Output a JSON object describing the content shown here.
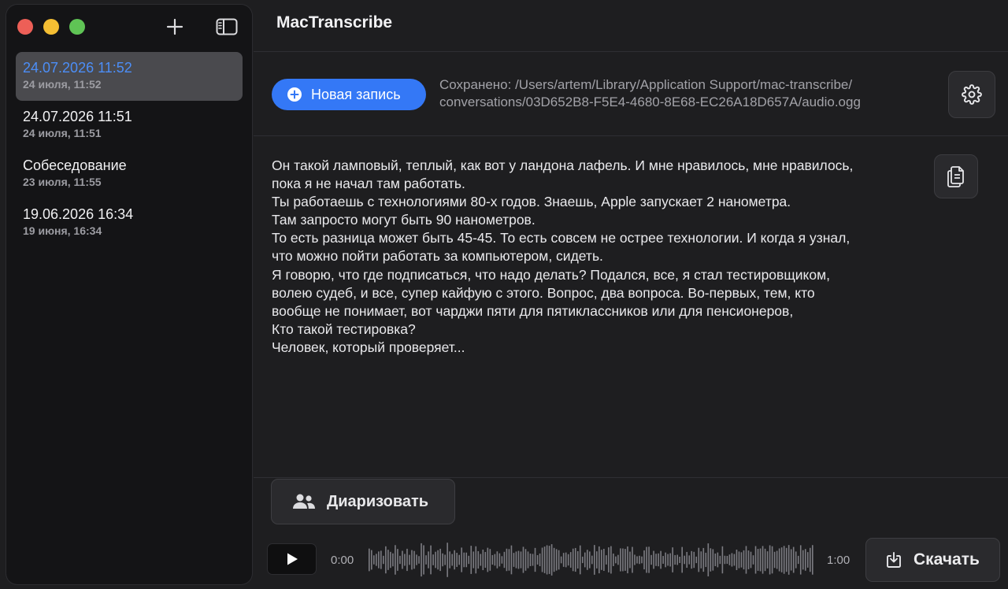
{
  "app": {
    "title": "MacTranscribe"
  },
  "sidebar": {
    "items": [
      {
        "title": "24.07.2026 11:52",
        "subtitle": "24 июля, 11:52",
        "selected": true
      },
      {
        "title": "24.07.2026 11:51",
        "subtitle": "24 июля, 11:51",
        "selected": false
      },
      {
        "title": "Собеседование",
        "subtitle": "23 июля, 11:55",
        "selected": false
      },
      {
        "title": "19.06.2026 16:34",
        "subtitle": "19 июня, 16:34",
        "selected": false
      }
    ]
  },
  "toolbar": {
    "new_recording_label": "Новая запись",
    "saved_line1": "Сохранено: /Users/artem/Library/Application Support/mac-transcribe/",
    "saved_line2": "conversations/03D652B8-F5E4-4680-8E68-EC26A18D657A/audio.ogg"
  },
  "transcript": {
    "lines": [
      "Он такой ламповый, теплый, как вот у ландона лафель. И мне нравилось, мне нравилось,",
      "пока я не начал там работать.",
      "Ты работаешь с технологиями 80-х годов. Знаешь, Apple запускает 2 нанометра.",
      "Там запросто могут быть 90 нанометров.",
      "То есть разница может быть 45-45. То есть совсем не острее технологии. И когда я узнал,",
      "что можно пойти работать за компьютером, сидеть.",
      "Я говорю, что где подписаться, что надо делать? Подался, все, я стал тестировщиком,",
      "волею судеб, и все, супер кайфую с этого. Вопрос, два вопроса. Во-первых, тем, кто",
      "вообще не понимает, вот чарджи пяти для пятиклассников или для пенсионеров,",
      "Кто такой тестировка?",
      "Человек, который проверяет..."
    ]
  },
  "actions": {
    "diarize_label": "Диаризовать",
    "download_label": "Скачать"
  },
  "player": {
    "current_time": "0:00",
    "duration": "1:00",
    "progress": 0
  },
  "colors": {
    "accent": "#3478f6",
    "selected_text": "#4c8ef7"
  }
}
